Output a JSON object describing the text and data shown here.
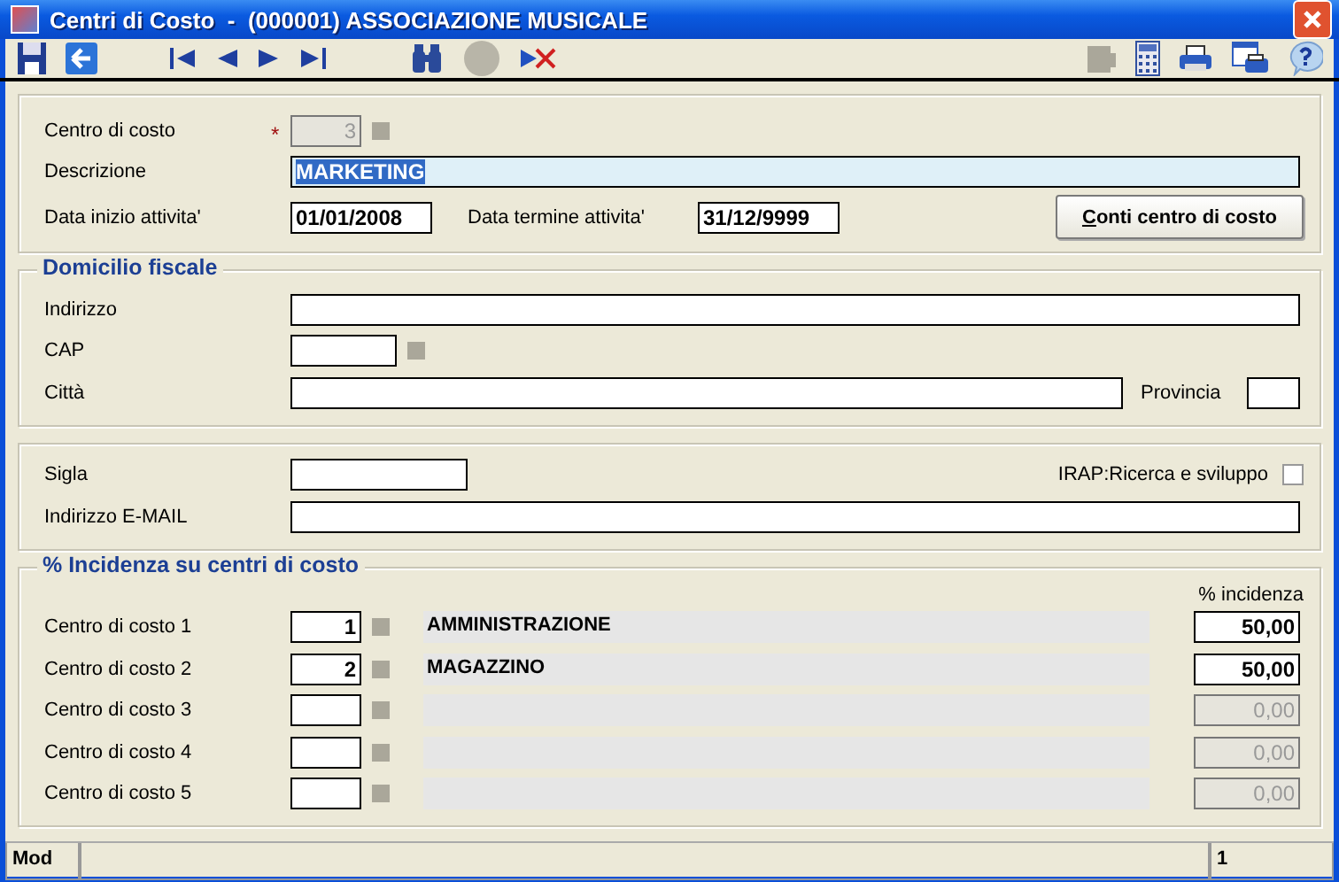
{
  "window": {
    "title": "Centri di Costo  -  (000001) ASSOCIAZIONE MUSICALE"
  },
  "general": {
    "code": {
      "label": "Centro di costo",
      "value": "3",
      "required_mark": "*",
      "disabled": true
    },
    "description": {
      "label": "Descrizione",
      "value": "MARKETING",
      "selected": true
    },
    "start_date": {
      "label": "Data inizio attivita'",
      "value": "01/01/2008"
    },
    "end_date": {
      "label": "Data termine attivita'",
      "value": "31/12/9999"
    },
    "button": "Conti centro di costo"
  },
  "domicilio": {
    "legend": "Domicilio fiscale",
    "address": {
      "label": "Indirizzo"
    },
    "cap": {
      "label": "CAP"
    },
    "city": {
      "label": "Città"
    },
    "province": {
      "label": "Provincia"
    }
  },
  "extra": {
    "sigla": {
      "label": "Sigla"
    },
    "irap": {
      "label": "IRAP:Ricerca e sviluppo",
      "checked": false
    },
    "email": {
      "label": "Indirizzo E-MAIL"
    }
  },
  "incidenza": {
    "legend": "% Incidenza su centri di costo",
    "column_header": "% incidenza",
    "rows": [
      {
        "label": "Centro di costo 1",
        "code": "1",
        "name": "AMMINISTRAZIONE",
        "percent": "50,00",
        "disabled": false
      },
      {
        "label": "Centro di costo 2",
        "code": "2",
        "name": "MAGAZZINO",
        "percent": "50,00",
        "disabled": false
      },
      {
        "label": "Centro di costo 3",
        "percent": "0,00",
        "disabled": true
      },
      {
        "label": "Centro di costo 4",
        "percent": "0,00",
        "disabled": true
      },
      {
        "label": "Centro di costo 5",
        "percent": "0,00",
        "disabled": true
      }
    ]
  },
  "status_bar": {
    "mode": "Mod",
    "page": "1"
  }
}
